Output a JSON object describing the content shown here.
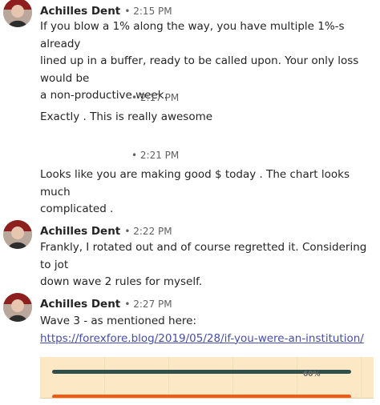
{
  "messages": [
    {
      "author": "Achilles Dent",
      "time": "• 2:15 PM",
      "lines": [
        "If you blow a 1% along the way, you have multiple 1%-s already",
        "lined up in a buffer, ready to be called upon. Your only loss would be",
        "a non-productive week."
      ]
    },
    {
      "time": "• 2:17 PM",
      "lines": [
        "Exactly . This is really awesome"
      ]
    },
    {
      "time": "• 2:21 PM",
      "lines": [
        "Looks like you are making good $ today . The chart looks much",
        "complicated ."
      ]
    },
    {
      "author": "Achilles Dent",
      "time": "• 2:22 PM",
      "lines": [
        "Frankly, I rotated out and of course regretted it. Considering to jot",
        "down wave 2 rules for myself."
      ]
    },
    {
      "author": "Achilles Dent",
      "time": "• 2:27 PM",
      "lines": [
        "Wave 3 - as mentioned here:"
      ],
      "link": "https://forexfore.blog/2019/05/28/if-you-were-an-institution/"
    }
  ],
  "attachment": {
    "label": "60%",
    "colors": {
      "background": "#fde8c5",
      "bar_dark": "#2f4f4a",
      "bar_orange": "#f05a14"
    }
  }
}
